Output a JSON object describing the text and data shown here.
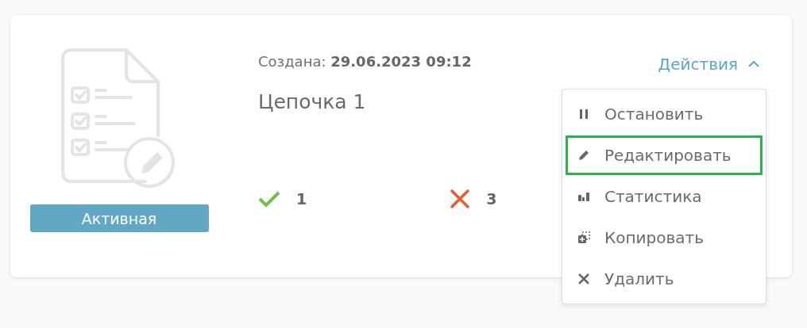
{
  "card": {
    "created_label": "Создана:",
    "created_value": "29.06.2023 09:12",
    "title": "Цепочка 1",
    "status": "Активная",
    "success_count": "1",
    "error_count": "3"
  },
  "actions": {
    "label": "Действия",
    "expanded": true,
    "items": [
      {
        "kind": "pause",
        "label": "Остановить",
        "selected": false
      },
      {
        "kind": "edit",
        "label": "Редактировать",
        "selected": true
      },
      {
        "kind": "stats",
        "label": "Статистика",
        "selected": false
      },
      {
        "kind": "copy",
        "label": "Копировать",
        "selected": false
      },
      {
        "kind": "delete",
        "label": "Удалить",
        "selected": false
      }
    ]
  }
}
